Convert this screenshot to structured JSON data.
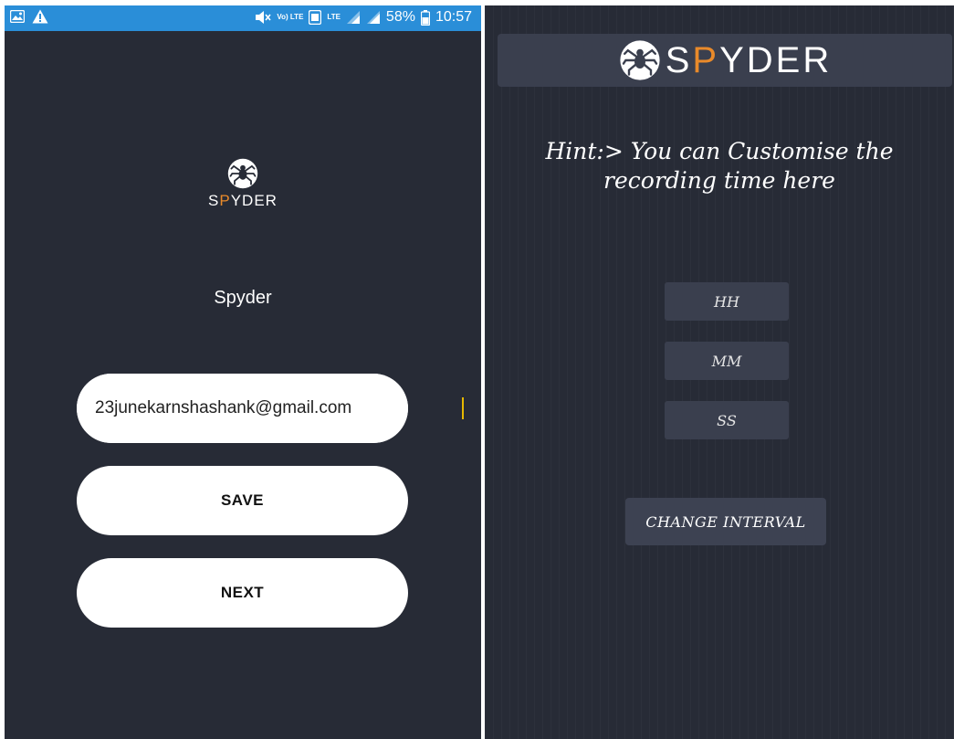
{
  "status_bar": {
    "battery_percent": "58%",
    "time": "10:57",
    "volte_label": "Vo) LTE",
    "lte_label": "LTE",
    "icons": [
      "image-icon",
      "warning-icon",
      "mute-icon",
      "volte-icon",
      "data-icon",
      "lte-icon",
      "signal-icon",
      "signal-icon",
      "battery-icon"
    ]
  },
  "left_screen": {
    "logo_text_part1": "S",
    "logo_text_accent": "P",
    "logo_text_part2": "YDER",
    "app_title": "Spyder",
    "email_value": "23junekarnshashank@gmail.com",
    "save_label": "SAVE",
    "next_label": "NEXT"
  },
  "right_screen": {
    "logo_text_part1": "S",
    "logo_text_accent": "P",
    "logo_text_part2": "YDER",
    "hint_line1": "Hint:> You can Customise the",
    "hint_line2": "recording time here",
    "hours_placeholder": "HH",
    "minutes_placeholder": "MM",
    "seconds_placeholder": "SS",
    "change_interval_label": "CHANGE INTERVAL"
  },
  "colors": {
    "background": "#272b36",
    "status_bar": "#2a8ed8",
    "accent": "#e98a2a",
    "field_bg": "#3a3f4e"
  }
}
